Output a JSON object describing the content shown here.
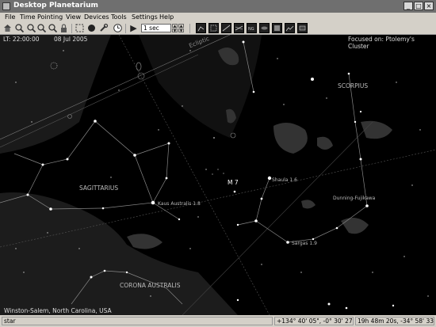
{
  "window": {
    "title": "Desktop Planetarium",
    "minimize": "_",
    "maximize": "□",
    "close": "×"
  },
  "menu": [
    "File",
    "Time",
    "Pointing",
    "View",
    "Devices",
    "Tools",
    "Settings",
    "Help"
  ],
  "toolbar": {
    "time_step": "1 sec",
    "spin_up": "▲",
    "spin_down": "▼",
    "play_glyph": "▶"
  },
  "sky": {
    "local_time": "LT: 22:00:00",
    "date": "08 Jul 2005",
    "focus": "Focused on: Ptolemy's Cluster",
    "location": "Winston-Salem, North Carolina,  USA",
    "labels": {
      "ecliptic": "Ecliptic",
      "scorpius": "SCORPIUS",
      "sagittarius": "SAGITTARIUS",
      "corona_australis": "CORONA AUSTRALIS",
      "m7": "M 7",
      "shaula": "Shaula 1.6",
      "kaus_australis": "Kaus Australis 1.8",
      "sargas": "Sargas 1.9",
      "dunning": "Dunning-Fujikawa"
    }
  },
  "status": {
    "object": "star",
    "altaz": "+134° 40' 05\",  -0° 30' 27\"",
    "radec": "19h 48m 20s,  -34° 58' 33\""
  }
}
